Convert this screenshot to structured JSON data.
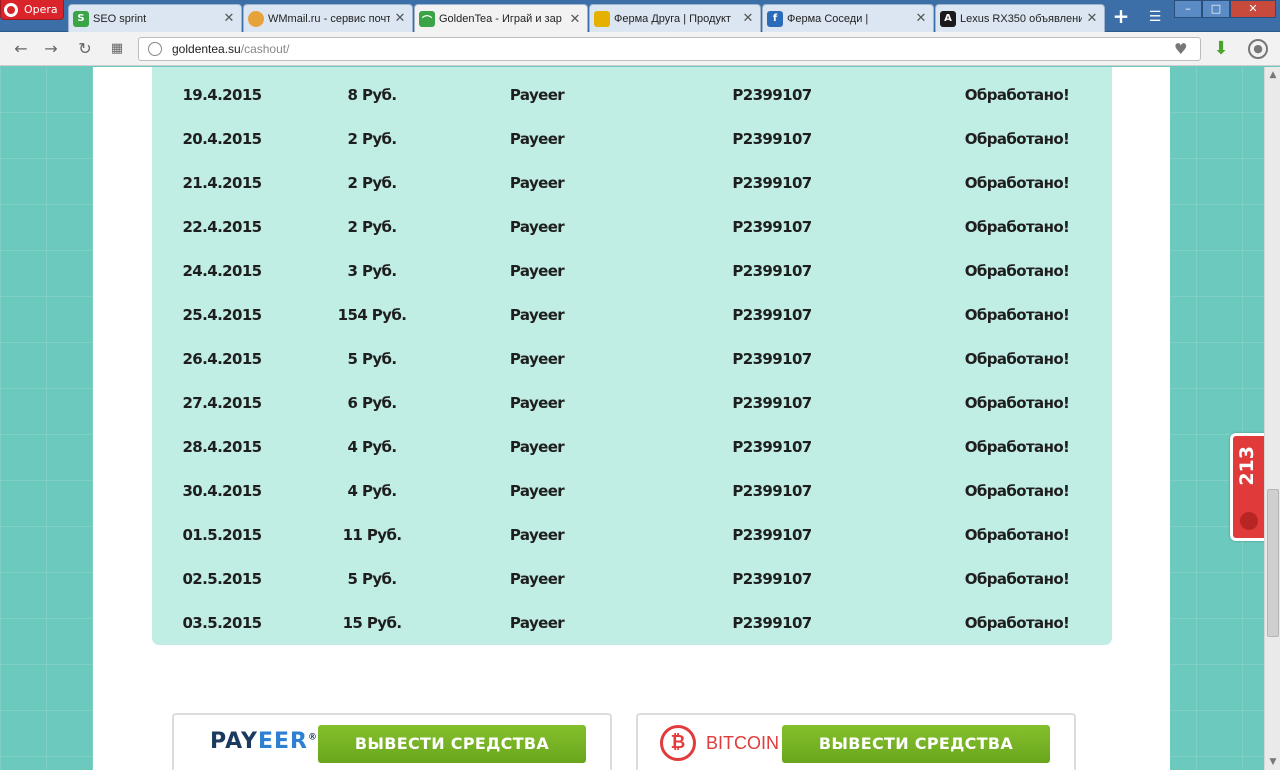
{
  "browser": {
    "menu_label": "Opera",
    "tabs": [
      {
        "title": "SEO sprint",
        "icon": "seosprint-favicon",
        "color": "#3aa447"
      },
      {
        "title": "WMmail.ru - сервис почт",
        "icon": "wmmail-favicon",
        "color": "#e8a23a"
      },
      {
        "title": "GoldenTea - Играй и зар",
        "icon": "goldentea-favicon",
        "color": "#3aa447"
      },
      {
        "title": "Ферма Друга | Продукт",
        "icon": "ferma-druga-favicon",
        "color": "#e5b000"
      },
      {
        "title": "Ферма Соседи |",
        "icon": "ferma-sosedi-favicon",
        "color": "#2b6bb8"
      },
      {
        "title": "Lexus RX350 объявлени",
        "icon": "autobazar-favicon",
        "color": "#1a1a1a"
      }
    ],
    "url_host": "goldentea.su",
    "url_path": "/cashout/"
  },
  "payouts": [
    {
      "date": "19.4.2015",
      "amount": "8 Руб.",
      "system": "Payeer",
      "wallet": "P2399107",
      "status": "Обработано!"
    },
    {
      "date": "20.4.2015",
      "amount": "2 Руб.",
      "system": "Payeer",
      "wallet": "P2399107",
      "status": "Обработано!"
    },
    {
      "date": "21.4.2015",
      "amount": "2 Руб.",
      "system": "Payeer",
      "wallet": "P2399107",
      "status": "Обработано!"
    },
    {
      "date": "22.4.2015",
      "amount": "2 Руб.",
      "system": "Payeer",
      "wallet": "P2399107",
      "status": "Обработано!"
    },
    {
      "date": "24.4.2015",
      "amount": "3 Руб.",
      "system": "Payeer",
      "wallet": "P2399107",
      "status": "Обработано!"
    },
    {
      "date": "25.4.2015",
      "amount": "154 Руб.",
      "system": "Payeer",
      "wallet": "P2399107",
      "status": "Обработано!"
    },
    {
      "date": "26.4.2015",
      "amount": "5 Руб.",
      "system": "Payeer",
      "wallet": "P2399107",
      "status": "Обработано!"
    },
    {
      "date": "27.4.2015",
      "amount": "6 Руб.",
      "system": "Payeer",
      "wallet": "P2399107",
      "status": "Обработано!"
    },
    {
      "date": "28.4.2015",
      "amount": "4 Руб.",
      "system": "Payeer",
      "wallet": "P2399107",
      "status": "Обработано!"
    },
    {
      "date": "30.4.2015",
      "amount": "4 Руб.",
      "system": "Payeer",
      "wallet": "P2399107",
      "status": "Обработано!"
    },
    {
      "date": "01.5.2015",
      "amount": "11 Руб.",
      "system": "Payeer",
      "wallet": "P2399107",
      "status": "Обработано!"
    },
    {
      "date": "02.5.2015",
      "amount": "5 Руб.",
      "system": "Payeer",
      "wallet": "P2399107",
      "status": "Обработано!"
    },
    {
      "date": "03.5.2015",
      "amount": "15 Руб.",
      "system": "Payeer",
      "wallet": "P2399107",
      "status": "Обработано!"
    }
  ],
  "withdraw": {
    "payeer_logo_a": "PAY",
    "payeer_logo_b": "EER",
    "payeer_logo_reg": "®",
    "bitcoin_label": "BITCOIN",
    "button_label": "ВЫВЕСТИ СРЕДСТВА"
  },
  "side_badge": {
    "count": "213"
  },
  "colors": {
    "accent_green": "#7ab828",
    "table_bg": "#c0ede4",
    "bitcoin_red": "#e23b3b",
    "page_bg": "#6cc9bd"
  }
}
